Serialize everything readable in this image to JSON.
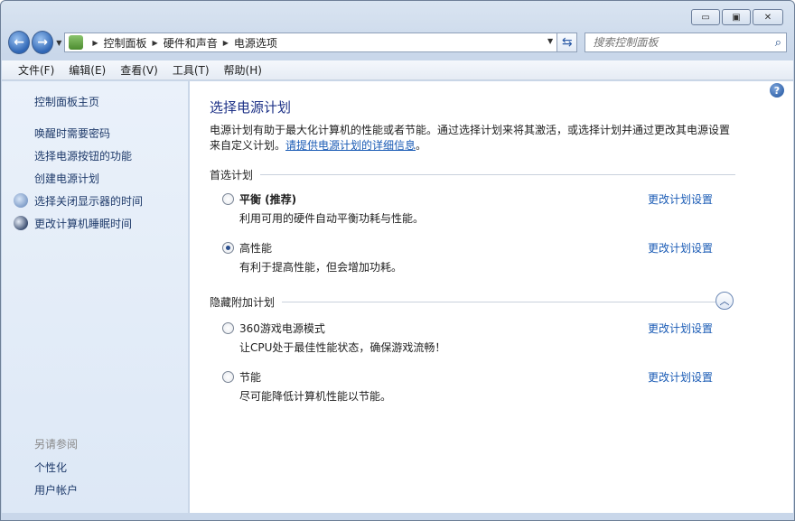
{
  "window": {
    "minimize_icon": "minimize-icon",
    "maximize_icon": "maximize-icon",
    "close_icon": "close-icon"
  },
  "navigation": {
    "breadcrumb": [
      "控制面板",
      "硬件和声音",
      "电源选项"
    ],
    "search_placeholder": "搜索控制面板"
  },
  "menu": [
    "文件(F)",
    "编辑(E)",
    "查看(V)",
    "工具(T)",
    "帮助(H)"
  ],
  "sidebar": {
    "home": "控制面板主页",
    "links": [
      "唤醒时需要密码",
      "选择电源按钮的功能",
      "创建电源计划",
      "选择关闭显示器的时间",
      "更改计算机睡眠时间"
    ],
    "see_also_header": "另请参阅",
    "see_also": [
      "个性化",
      "用户帐户"
    ]
  },
  "main": {
    "title": "选择电源计划",
    "intro_line1": "电源计划有助于最大化计算机的性能或者节能。通过选择计划来将其激活，或选择计划并通过更改其电源设置",
    "intro_line2_prefix": "来自定义计划。",
    "intro_link": "请提供电源计划的详细信息",
    "intro_suffix": "。",
    "preferred_header": "首选计划",
    "hidden_header": "隐藏附加计划",
    "change_link": "更改计划设置",
    "preferred_plans": [
      {
        "name": "平衡 (推荐)",
        "desc": "利用可用的硬件自动平衡功耗与性能。",
        "selected": false
      },
      {
        "name": "高性能",
        "desc": "有利于提高性能，但会增加功耗。",
        "selected": true
      }
    ],
    "hidden_plans": [
      {
        "name": "360游戏电源模式",
        "desc": "让CPU处于最佳性能状态，确保游戏流畅！",
        "selected": false
      },
      {
        "name": "节能",
        "desc": "尽可能降低计算机性能以节能。",
        "selected": false
      }
    ]
  }
}
